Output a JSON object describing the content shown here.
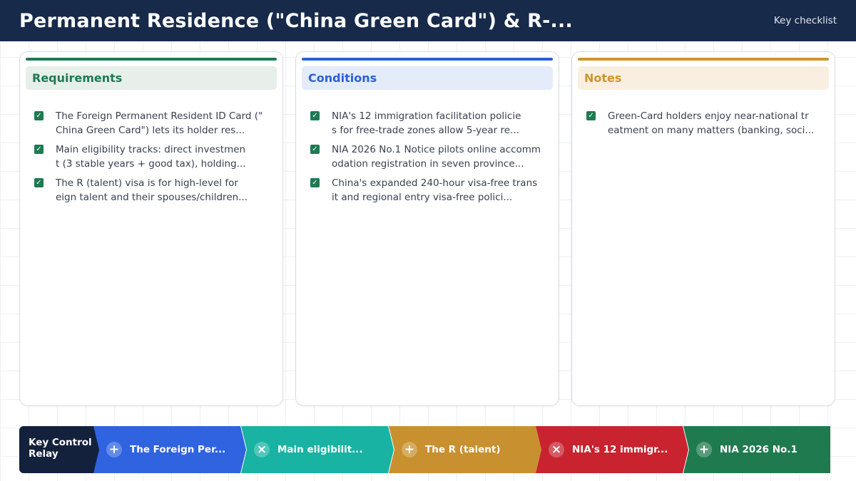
{
  "header": {
    "title": "Permanent Residence (\"China Green Card\") & R-...",
    "subtitle": "Key checklist"
  },
  "columns": [
    {
      "title": "Requirements",
      "accent": "#1d7a52",
      "head_bg": "#e6efe9",
      "items": [
        "The Foreign Permanent Resident ID Card (\"\nChina Green Card\") lets its holder res...",
        "Main eligibility tracks: direct investmen\nt (3 stable years + good tax), holding...",
        "The R (talent) visa is for high-level for\neign talent and their spouses/children..."
      ]
    },
    {
      "title": "Conditions",
      "accent": "#2b5fd9",
      "head_bg": "#e4ecfa",
      "items": [
        "NIA's 12 immigration facilitation policie\ns for free-trade zones allow 5-year re...",
        "NIA 2026 No.1 Notice pilots online accomm\nodation registration in seven province...",
        "China's expanded 240-hour visa-free trans\nit and regional entry visa-free polici..."
      ]
    },
    {
      "title": "Notes",
      "accent": "#d0952a",
      "head_bg": "#f8efe0",
      "items": [
        "Green-Card holders enjoy near-national tr\neatment on many matters (banking, soci..."
      ]
    }
  ],
  "relay": {
    "label": "Key Control Relay",
    "segments": [
      {
        "icon": "+",
        "icon_name": "plus-icon",
        "label": "The Foreign Per...",
        "color": "#2f63e0"
      },
      {
        "icon": "×",
        "icon_name": "close-icon",
        "label": "Main eligibilit...",
        "color": "#19b3a3"
      },
      {
        "icon": "+",
        "icon_name": "plus-icon",
        "label": "The R (talent)",
        "color": "#c8902e"
      },
      {
        "icon": "×",
        "icon_name": "close-icon",
        "label": "NIA's 12 immigr...",
        "color": "#c8232f"
      },
      {
        "icon": "+",
        "icon_name": "plus-icon",
        "label": "NIA 2026 No.1",
        "color": "#1f7a4f"
      }
    ]
  }
}
